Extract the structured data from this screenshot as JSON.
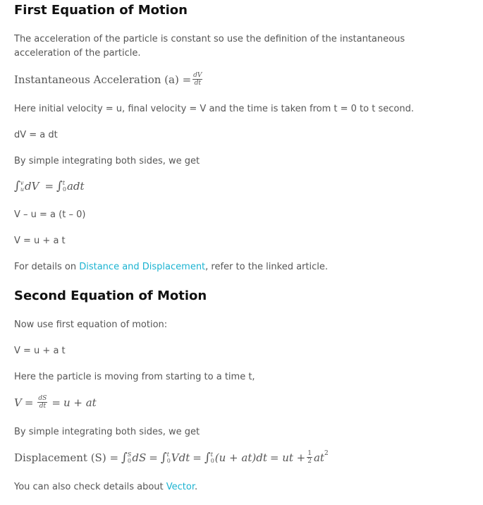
{
  "section1": {
    "heading": "First Equation of Motion",
    "intro": "The acceleration of the particle is constant so use the definition of the instantaneous acceleration of the particle.",
    "eq_accel": {
      "label": "Instantaneous Acceleration (a) =",
      "num": "dV",
      "den": "dt"
    },
    "here_text": "Here initial velocity = u, final velocity = V and the time is taken from t = 0 to t second.",
    "dv_line": "dV = a dt",
    "integrating_text": "By simple integrating both sides, we get",
    "eq_integral": {
      "lhs_upper": "v",
      "lhs_lower": "u",
      "lhs_body": "dV",
      "eq": "=",
      "rhs_upper": "t",
      "rhs_lower": "0",
      "rhs_body": "adt"
    },
    "v_minus_u": "V – u = a (t – 0)",
    "v_equals": "V = u + a t",
    "details_prefix": "For details on ",
    "details_link": "Distance and Displacement",
    "details_suffix": ", refer to the linked article."
  },
  "section2": {
    "heading": "Second Equation of Motion",
    "now_text": "Now use first equation of motion:",
    "v_equals": "V = u + a t",
    "here_text": "Here the particle is moving from starting to a time t,",
    "eq_velocity": {
      "lhs": "V",
      "eq1": "=",
      "num": "dS",
      "den": "dt",
      "eq2": "=",
      "rhs": "u + at"
    },
    "integrating_text": "By simple integrating both sides, we get",
    "eq_displacement": {
      "label": "Displacement (S) =",
      "i1_upper": "S",
      "i1_lower": "0",
      "i1_body": "dS",
      "i2_upper": "t",
      "i2_lower": "0",
      "i2_body": "Vdt",
      "i3_upper": "t",
      "i3_lower": "0",
      "i3_body": "(u + at)dt",
      "result": "= ut +",
      "half_num": "1",
      "half_den": "2",
      "tail": "at",
      "power": "2"
    },
    "also_prefix": "You can also check details about ",
    "also_link": "Vector",
    "also_suffix": "."
  },
  "colors": {
    "text": "#555555",
    "heading": "#111111",
    "link": "#1bb3d1"
  }
}
